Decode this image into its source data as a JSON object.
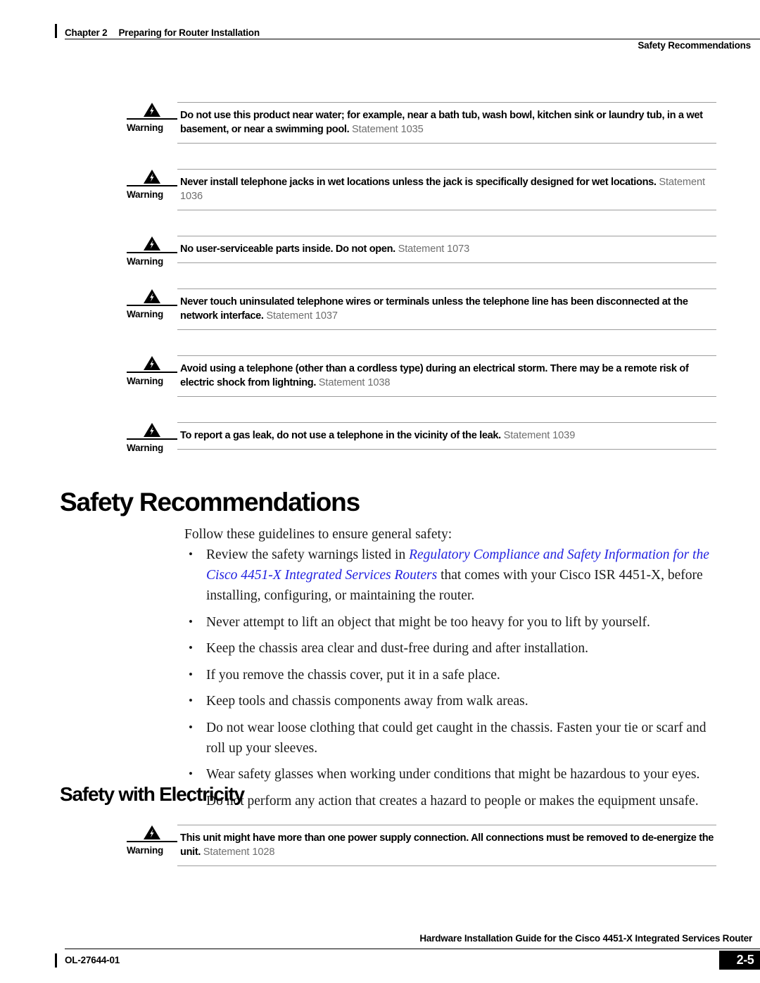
{
  "header": {
    "chapter": "Chapter 2",
    "chapter_title": "Preparing for Router Installation",
    "section": "Safety Recommendations"
  },
  "warning_label": "Warning",
  "warnings_top": [
    {
      "text": "Do not use this product near water; for example, near a bath tub, wash bowl, kitchen sink or laundry tub, in a wet basement, or near a swimming pool.",
      "statement": "Statement 1035"
    },
    {
      "text": "Never install telephone jacks in wet locations unless the jack is specifically designed for wet locations.",
      "statement": "Statement 1036"
    },
    {
      "text": "No user-serviceable parts inside.  Do not open.",
      "statement": "Statement 1073"
    },
    {
      "text": "Never touch uninsulated telephone wires or terminals unless the telephone line has been disconnected at the network interface.",
      "statement": "Statement 1037"
    },
    {
      "text": "Avoid using a telephone (other than a cordless type) during an electrical storm. There may be a remote risk of electric shock from lightning.",
      "statement": "Statement 1038"
    },
    {
      "text": "To report a gas leak, do not use a telephone in the vicinity of the leak.",
      "statement": "Statement 1039"
    }
  ],
  "section_safety": {
    "heading": "Safety Recommendations",
    "intro": "Follow these guidelines to ensure general safety:",
    "bullets": [
      {
        "pre": "Review the safety warnings listed in ",
        "link": "Regulatory Compliance and Safety Information for the Cisco 4451-X Integrated Services Routers",
        "post": " that comes with your Cisco ISR 4451-X, before installing, configuring, or maintaining the router."
      },
      {
        "pre": "Never attempt to lift an object that might be too heavy for you to lift by yourself.",
        "link": "",
        "post": ""
      },
      {
        "pre": "Keep the chassis area clear and dust-free during and after installation.",
        "link": "",
        "post": ""
      },
      {
        "pre": "If you remove the chassis cover, put it in a safe place.",
        "link": "",
        "post": ""
      },
      {
        "pre": "Keep tools and chassis components away from walk areas.",
        "link": "",
        "post": ""
      },
      {
        "pre": "Do not wear loose clothing that could get caught in the chassis. Fasten your tie or scarf and roll up your sleeves.",
        "link": "",
        "post": ""
      },
      {
        "pre": "Wear safety glasses when working under conditions that might be hazardous to your eyes.",
        "link": "",
        "post": ""
      },
      {
        "pre": "Do not perform any action that creates a hazard to people or makes the equipment unsafe.",
        "link": "",
        "post": ""
      }
    ]
  },
  "section_electricity": {
    "heading": "Safety with Electricity",
    "warning": {
      "text": "This unit might have more than one power supply connection. All connections must be removed to de-energize the unit.",
      "statement": "Statement 1028"
    }
  },
  "footer": {
    "title": "Hardware Installation Guide for the Cisco 4451-X Integrated Services Router",
    "doc_id": "OL-27644-01",
    "page": "2-5"
  },
  "colors": {
    "link": "#2222e0",
    "rule": "#9d9d9d",
    "statement": "#6f6f6f"
  }
}
